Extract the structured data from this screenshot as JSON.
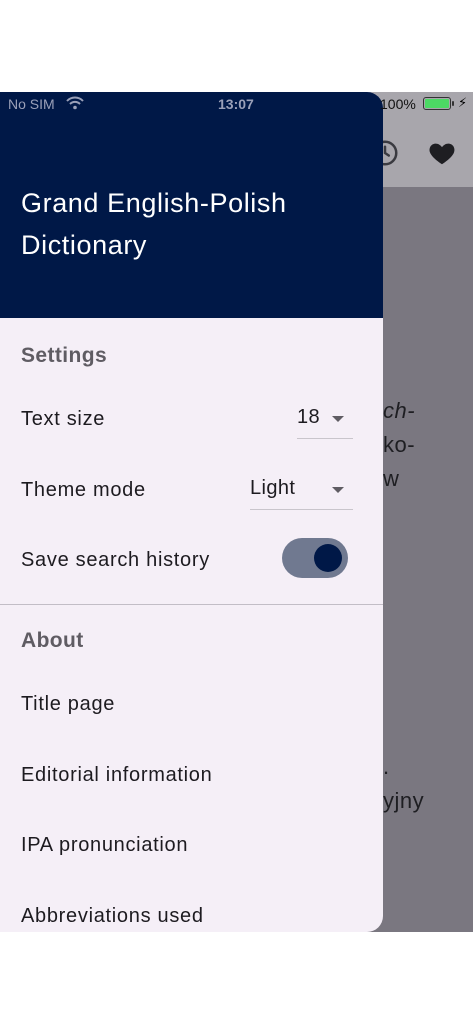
{
  "status_bar": {
    "carrier": "No SIM",
    "time": "13:07",
    "battery": "100%"
  },
  "background_page": {
    "icons": [
      "history-icon",
      "heart-icon"
    ],
    "text_fragments": [
      "ch-",
      "ko-",
      "w",
      ".",
      "yjny"
    ]
  },
  "drawer": {
    "title": "Grand English-Polish Dictionary",
    "settings": {
      "title": "Settings",
      "text_size": {
        "label": "Text size",
        "value": "18"
      },
      "theme_mode": {
        "label": "Theme mode",
        "value": "Light"
      },
      "save_history": {
        "label": "Save search history",
        "enabled": true
      }
    },
    "about": {
      "title": "About",
      "items": [
        {
          "label": "Title page"
        },
        {
          "label": "Editorial information"
        },
        {
          "label": "IPA pronunciation"
        },
        {
          "label": "Abbreviations used"
        }
      ]
    }
  },
  "colors": {
    "header": "#001847",
    "drawer_bg": "#f5eff7",
    "scrim": "#7a7780",
    "switch_track": "#707990",
    "switch_thumb": "#001847"
  }
}
